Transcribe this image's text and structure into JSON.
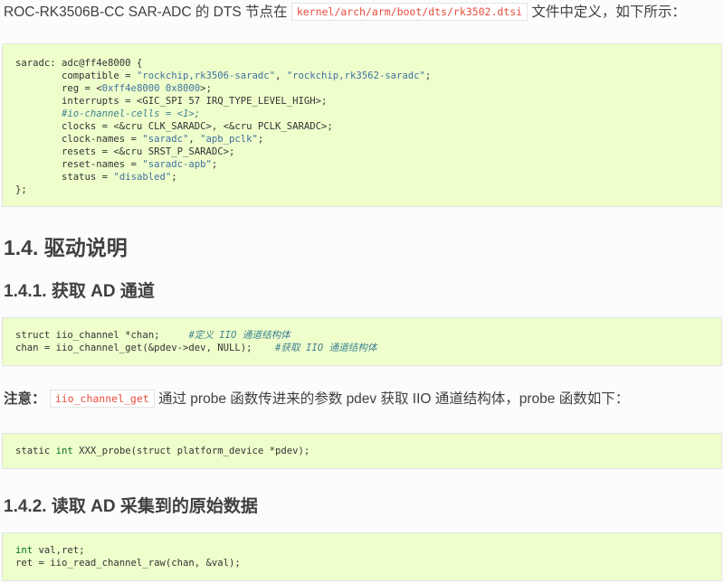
{
  "intro": {
    "text_before": "ROC-RK3506B-CC SAR-ADC 的 DTS 节点在",
    "path": "kernel/arch/arm/boot/dts/rk3502.dtsi",
    "text_after": "文件中定义，如下所示："
  },
  "dts_block": {
    "l1": "saradc: adc@ff4e8000 {",
    "l2_a": "        compatible = ",
    "l2_s1": "\"rockchip,rk3506-saradc\"",
    "l2_b": ", ",
    "l2_s2": "\"rockchip,rk3562-saradc\"",
    "l2_c": ";",
    "l3_a": "        reg = <",
    "l3_n": "0xff4e8000 0x8000",
    "l3_c": ">;",
    "l4": "        interrupts = <GIC_SPI 57 IRQ_TYPE_LEVEL_HIGH>;",
    "l5_indent": "        ",
    "l5_cm": "#io-channel-cells = <1>;",
    "l6": "        clocks = <&cru CLK_SARADC>, <&cru PCLK_SARADC>;",
    "l7_a": "        clock-names = ",
    "l7_s1": "\"saradc\"",
    "l7_b": ", ",
    "l7_s2": "\"apb_pclk\"",
    "l7_c": ";",
    "l8": "        resets = <&cru SRST_P_SARADC>;",
    "l9_a": "        reset-names = ",
    "l9_s": "\"saradc-apb\"",
    "l9_c": ";",
    "l10_a": "        status = ",
    "l10_s": "\"disabled\"",
    "l10_c": ";",
    "l11": "};"
  },
  "section": {
    "title": "1.4. 驱动说明"
  },
  "subsection1": {
    "title": "1.4.1. 获取 AD 通道"
  },
  "code1": {
    "l1_a": "struct iio_channel *chan;     ",
    "l1_cm": "#定义 IIO 通道结构体",
    "l2_a": "chan = iio_channel_get(&pdev->dev, NULL);    ",
    "l2_cm": "#获取 IIO 通道结构体"
  },
  "note": {
    "label": "注意：",
    "code": "iio_channel_get",
    "text": "通过 probe 函数传进来的参数 pdev 获取 IIO 通道结构体，probe 函数如下："
  },
  "code2": {
    "a": "static ",
    "kw": "int",
    "b": " XXX_probe(struct platform_device *pdev);"
  },
  "subsection2": {
    "title": "1.4.2. 读取 AD 采集到的原始数据"
  },
  "code3": {
    "l1_kw": "int",
    "l1_b": " val,ret;",
    "l2": "ret = iio_read_channel_raw(chan, &val);"
  }
}
